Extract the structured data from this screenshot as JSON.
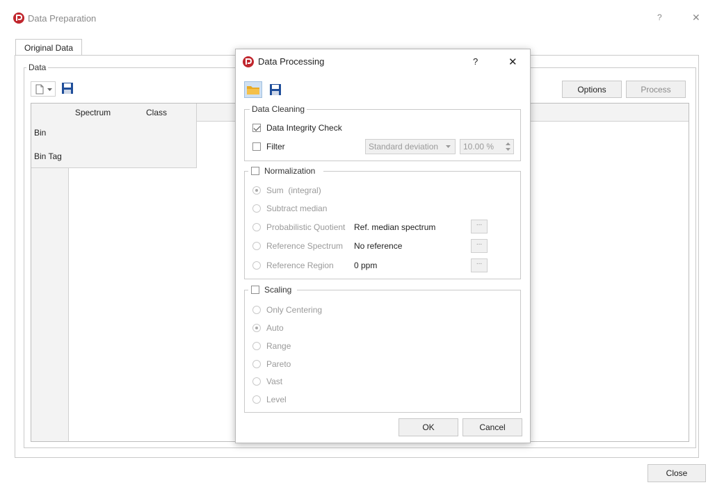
{
  "main_window": {
    "title": "Data Preparation",
    "help_glyph": "?",
    "close_glyph": "✕",
    "tab_label": "Original Data",
    "group_label": "Data",
    "options_label": "Options",
    "process_label": "Process",
    "close_button_label": "Close",
    "table": {
      "columns": [
        "Spectrum",
        "Class"
      ],
      "rows": [
        "Bin",
        "Bin Tag"
      ]
    }
  },
  "dialog": {
    "title": "Data Processing",
    "help_glyph": "?",
    "close_glyph": "✕",
    "data_cleaning": {
      "title": "Data Cleaning",
      "integrity_label": "Data Integrity Check",
      "integrity_checked": true,
      "filter_label": "Filter",
      "filter_method": "Standard deviation",
      "filter_value": "10.00 %"
    },
    "normalization": {
      "title": "Normalization",
      "options": [
        {
          "label": "Sum  (integral)",
          "selected": true,
          "value": ""
        },
        {
          "label": "Subtract median",
          "selected": false,
          "value": ""
        },
        {
          "label": "Probabilistic Quotient",
          "selected": false,
          "value": "Ref. median spectrum"
        },
        {
          "label": "Reference Spectrum",
          "selected": false,
          "value": "No reference"
        },
        {
          "label": "Reference Region",
          "selected": false,
          "value": "0 ppm"
        }
      ],
      "browse_label": "..."
    },
    "scaling": {
      "title": "Scaling",
      "options": [
        {
          "label": "Only Centering",
          "selected": false
        },
        {
          "label": "Auto",
          "selected": true
        },
        {
          "label": "Range",
          "selected": false
        },
        {
          "label": "Pareto",
          "selected": false
        },
        {
          "label": "Vast",
          "selected": false
        },
        {
          "label": "Level",
          "selected": false
        }
      ]
    },
    "ok_label": "OK",
    "cancel_label": "Cancel"
  },
  "colors": {
    "brand_red": "#c0262d",
    "folder_yellow": "#e8a923",
    "floppy_blue": "#1f4e9a"
  }
}
